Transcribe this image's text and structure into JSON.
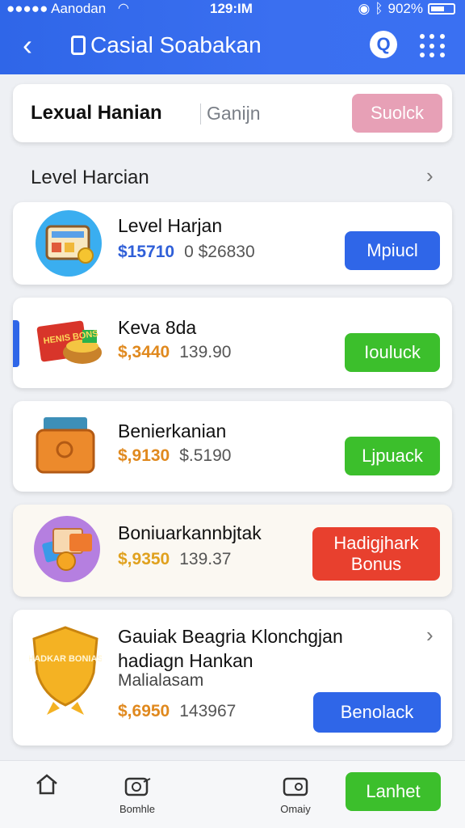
{
  "status": {
    "carrier": "●●●●● Aanodan",
    "time": "129:IM",
    "battery": "902%"
  },
  "header": {
    "title": "Casial Soabakan",
    "q_label": "Q"
  },
  "search": {
    "label": "Lexual Hanian",
    "placeholder": "Ganijn",
    "button": "Suolck"
  },
  "section": {
    "title": "Level Harcian"
  },
  "items": [
    {
      "name": "Level Harjan",
      "price_a": "$15710",
      "price_b": "0 $26830",
      "button": "Mpiucl",
      "price_color": "#2f5fd8",
      "button_color": "#2f66e8",
      "icon": "lottery-ticket-icon"
    },
    {
      "name": "Keva 8da",
      "price_a": "$,3440",
      "price_b": "139.90",
      "button": "Iouluck",
      "price_color": "#e0891e",
      "button_color": "#3cbf2c",
      "icon": "bonus-basket-icon"
    },
    {
      "name": "Benierkanian",
      "price_a": "$,9130",
      "price_b": "$.5190",
      "button": "Ljpuack",
      "price_color": "#e0891e",
      "button_color": "#3cbf2c",
      "icon": "wallet-icon"
    },
    {
      "name": "Boniuarkannbjtak",
      "price_a": "$,9350",
      "price_b": "139.37",
      "button": "Hadigjhark Bonus",
      "price_color": "#e0a11e",
      "button_color": "#e8402e",
      "icon": "cards-coin-icon"
    },
    {
      "name": "Gauiak Beagria Klonchgjan hadiagn Hankan",
      "subtitle": "Malialasam",
      "price_a": "$,6950",
      "price_b": "143967",
      "button": "Benolack",
      "price_color": "#e0891e",
      "button_color": "#2f66e8",
      "icon": "bonus-shield-icon"
    }
  ],
  "badge_texts": {
    "item2": "HENIS BONS",
    "item5": "HADKAR BONIAS"
  },
  "bottom": {
    "tab1": "",
    "tab2": "Bomhle",
    "tab3": "Omaiy",
    "cta": "Lanhet"
  }
}
